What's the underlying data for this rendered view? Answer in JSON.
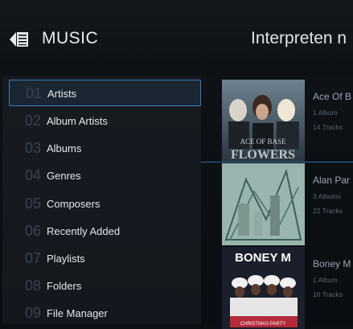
{
  "header": {
    "app_title": "MUSIC",
    "page_title": "Interpreten n"
  },
  "menu": {
    "items": [
      {
        "num": "01",
        "label": "Artists"
      },
      {
        "num": "02",
        "label": "Album Artists"
      },
      {
        "num": "03",
        "label": "Albums"
      },
      {
        "num": "04",
        "label": "Genres"
      },
      {
        "num": "05",
        "label": "Composers"
      },
      {
        "num": "06",
        "label": "Recently Added"
      },
      {
        "num": "07",
        "label": "Playlists"
      },
      {
        "num": "08",
        "label": "Folders"
      },
      {
        "num": "09",
        "label": "File Manager"
      }
    ],
    "selected_index": 0
  },
  "artists": [
    {
      "name": "Ace Of B",
      "albums": "1 Album",
      "tracks": "14 Tracks",
      "cover_text": "ACE OF BASE FLOWERS"
    },
    {
      "name": "Alan Par",
      "albums": "3 Albums",
      "tracks": "22 Tracks",
      "cover_text": ""
    },
    {
      "name": "Boney M",
      "albums": "1 Album",
      "tracks": "16 Tracks",
      "cover_text": "BONEY M"
    }
  ],
  "colors": {
    "accent": "#3b7fb9",
    "background": "#0b0e12"
  }
}
